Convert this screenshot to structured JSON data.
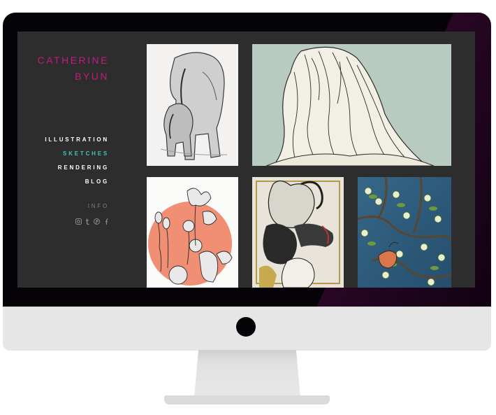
{
  "site": {
    "title_line1": "CATHERINE",
    "title_line2": "BYUN",
    "brand_color": "#c21b80",
    "active_color": "#3ec3c0"
  },
  "nav": {
    "items": [
      {
        "label": "ILLUSTRATION",
        "active": false
      },
      {
        "label": "SKETCHES",
        "active": true
      },
      {
        "label": "RENDERING",
        "active": false
      },
      {
        "label": "BLOG",
        "active": false
      }
    ],
    "info_label": "INFO"
  },
  "social": [
    "instagram-icon",
    "tumblr-icon",
    "pinterest-icon",
    "facebook-icon"
  ],
  "gallery": [
    {
      "subject": "elephant sketch"
    },
    {
      "subject": "woman with long hair from behind"
    },
    {
      "subject": "flowers on coral circle"
    },
    {
      "subject": "goat and dogs illustration"
    },
    {
      "subject": "bird on blossoming branch"
    }
  ]
}
